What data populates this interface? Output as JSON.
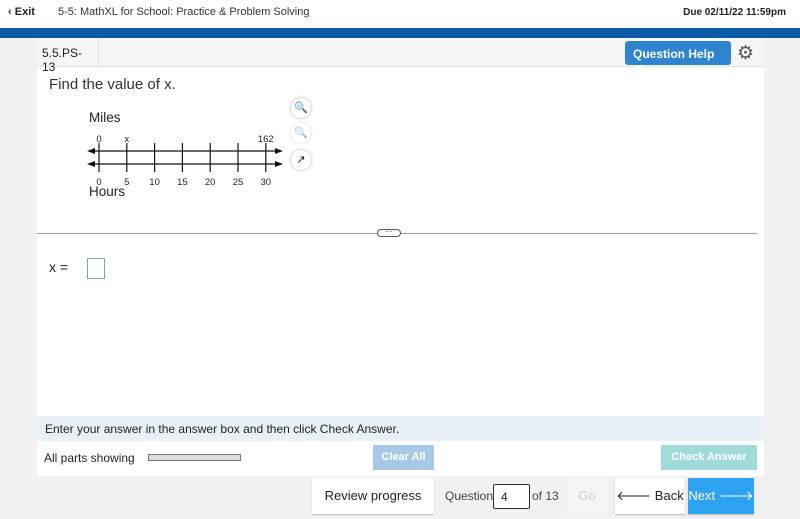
{
  "topbar": {
    "exit": "Exit",
    "title": "5-5: MathXL for School: Practice & Problem Solving",
    "due": "Due 02/11/22 11:59pm"
  },
  "question": {
    "id": "5.5.PS-13",
    "help": "Question Help",
    "prompt": "Find the value of x."
  },
  "figure": {
    "top_label": "Miles",
    "bottom_label": "Hours",
    "top_ticks": [
      "0",
      "x",
      "",
      "",
      "",
      "",
      "162"
    ],
    "bottom_ticks": [
      "0",
      "5",
      "10",
      "15",
      "20",
      "25",
      "30"
    ]
  },
  "answer": {
    "label": "x =",
    "value": ""
  },
  "footer": {
    "hint": "Enter your answer in the answer box and then click Check Answer.",
    "parts": "All parts showing",
    "clear": "Clear All",
    "check": "Check Answer"
  },
  "nav": {
    "review": "Review progress",
    "question_label": "Question",
    "question_value": "4",
    "of": "of 13",
    "go": "Go",
    "back": "Back",
    "next": "Next"
  },
  "colors": {
    "band": "#0b5ca8",
    "help": "#2f84d0",
    "next": "#2ea3f2"
  }
}
